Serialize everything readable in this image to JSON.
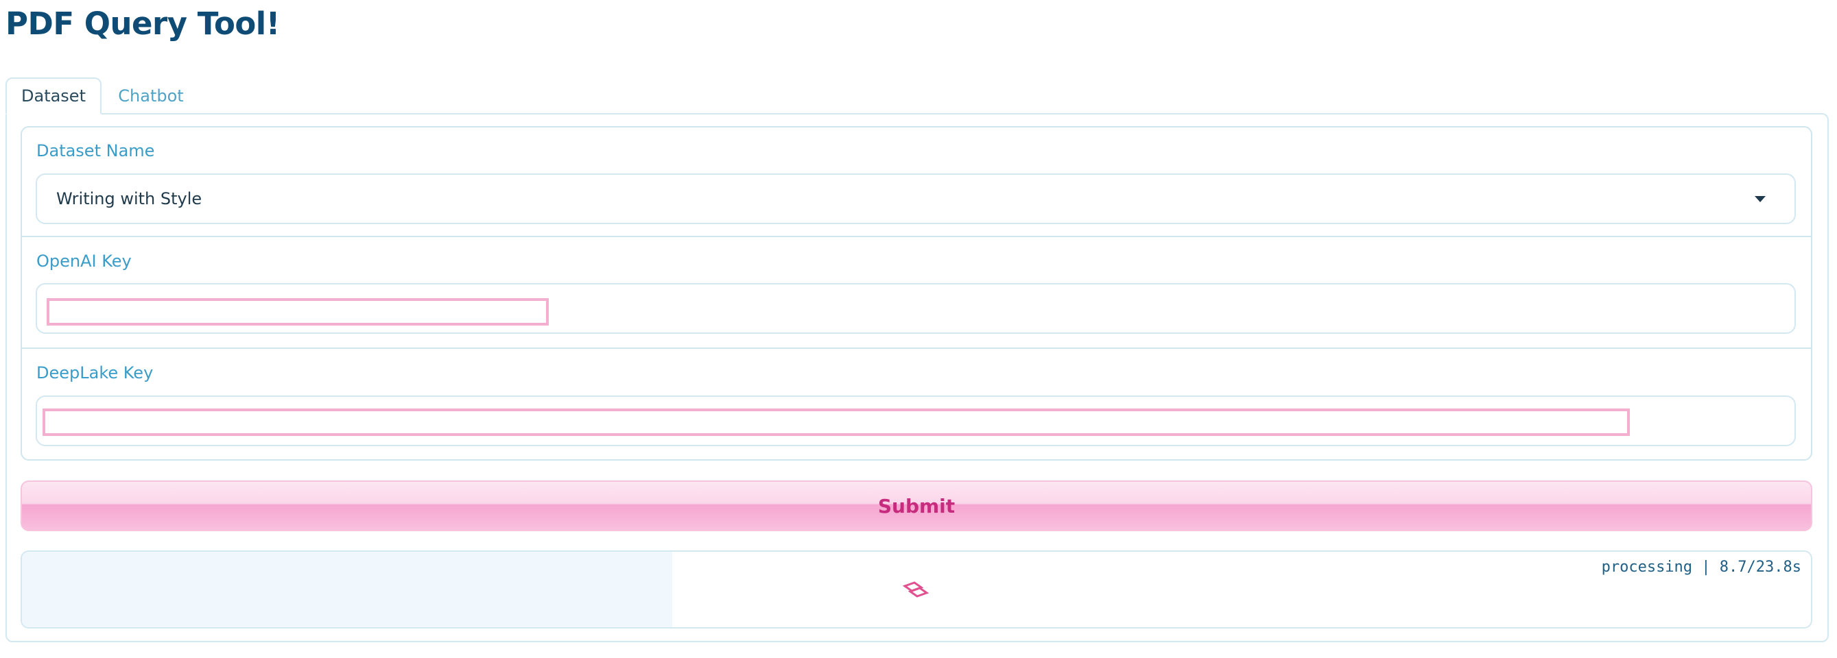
{
  "app": {
    "title": "PDF Query Tool!"
  },
  "tabs": [
    {
      "label": "Dataset",
      "active": true
    },
    {
      "label": "Chatbot",
      "active": false
    }
  ],
  "form": {
    "dataset_name": {
      "label": "Dataset Name",
      "selected": "Writing with Style",
      "icon": "chevron-down-icon"
    },
    "openai_key": {
      "label": "OpenAI Key",
      "value": ""
    },
    "deeplake_key": {
      "label": "DeepLake Key",
      "value": ""
    }
  },
  "actions": {
    "submit_label": "Submit"
  },
  "output": {
    "status": "processing | 8.7/23.8s",
    "elapsed_seconds": 8.7,
    "estimated_seconds": 23.8,
    "loader_icon": "loading-spinner-icon"
  },
  "colors": {
    "title": "#0f4c75",
    "label": "#3a9cc8",
    "accent": "#c72b7e",
    "border": "#d4e8f2",
    "input_highlight": "#f4aecf"
  }
}
